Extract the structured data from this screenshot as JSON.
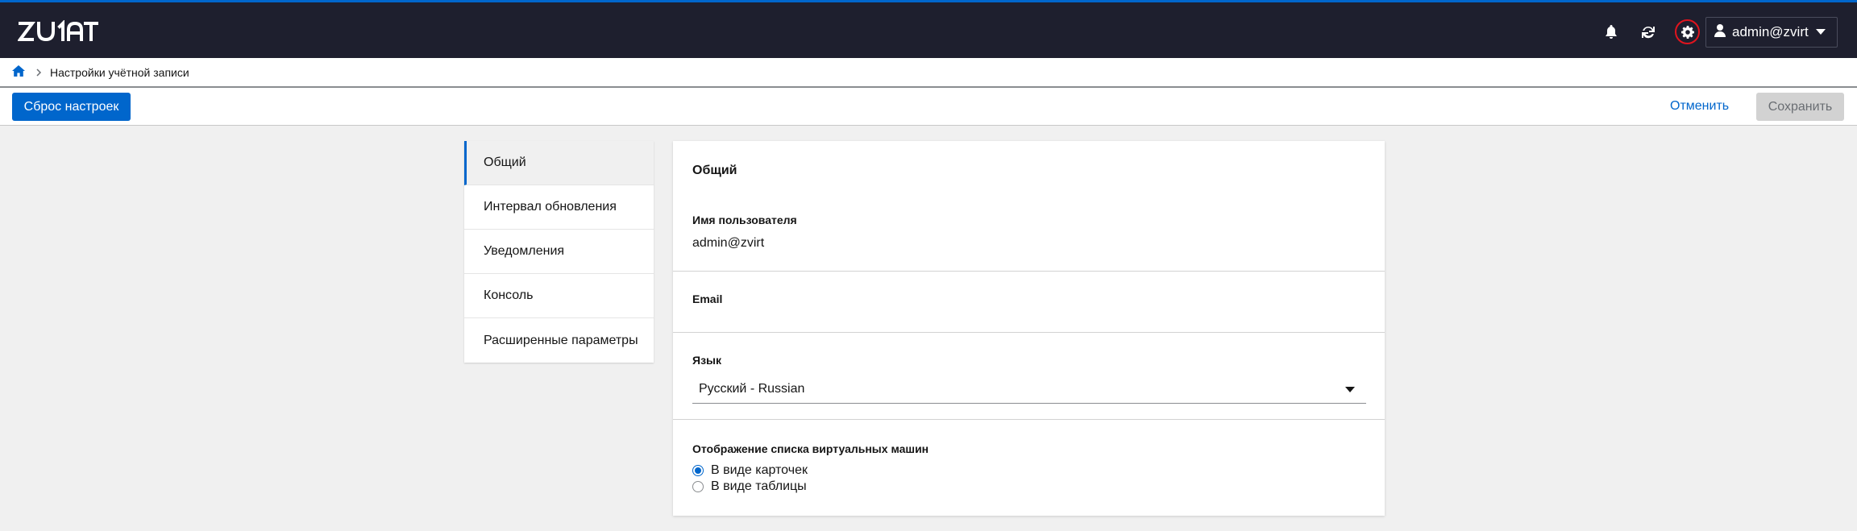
{
  "header": {
    "logo_text": "ZVIRT",
    "user_label": "admin@zvirt",
    "icons": [
      "bell-icon",
      "refresh-icon",
      "gear-icon",
      "user-icon",
      "chevron-down-icon"
    ]
  },
  "breadcrumb": {
    "current": "Настройки учётной записи"
  },
  "toolbar": {
    "reset_label": "Сброс настроек",
    "cancel_label": "Отменить",
    "save_label": "Сохранить"
  },
  "sidenav": {
    "items": [
      {
        "label": "Общий",
        "active": true
      },
      {
        "label": "Интервал обновления"
      },
      {
        "label": "Уведомления"
      },
      {
        "label": "Консоль"
      },
      {
        "label": "Расширенные параметры"
      }
    ]
  },
  "general": {
    "title": "Общий",
    "username_label": "Имя пользователя",
    "username_value": "admin@zvirt",
    "email_label": "Email",
    "language_label": "Язык",
    "language_value": "Русский - Russian",
    "vm_view_label": "Отображение списка виртуальных машин",
    "vm_view_options": [
      {
        "label": "В виде карточек",
        "checked": true
      },
      {
        "label": "В виде таблицы",
        "checked": false
      }
    ]
  },
  "colors": {
    "header_bg": "#1e1f2e",
    "accent": "#0066cc",
    "highlight_ring": "#e0141e"
  }
}
